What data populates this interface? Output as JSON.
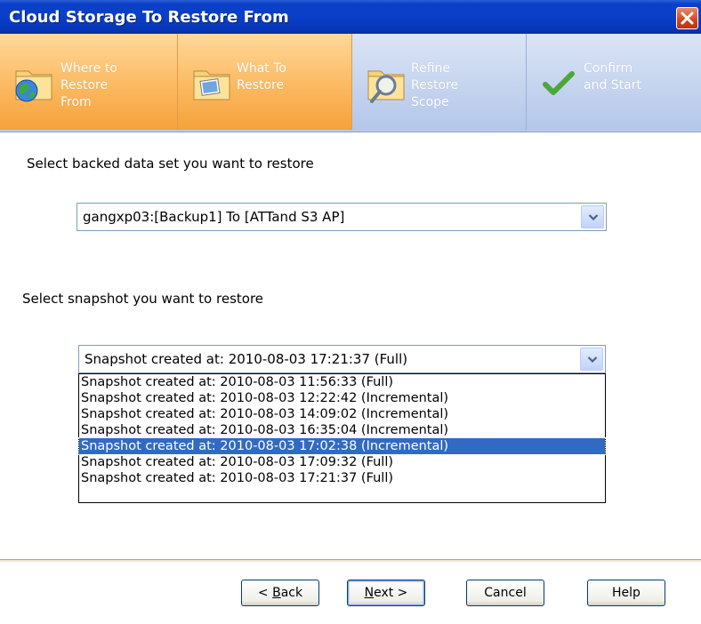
{
  "window": {
    "title": "Cloud Storage To Restore From"
  },
  "steps": [
    {
      "label_lines": [
        "Where to",
        "Restore",
        "From"
      ],
      "state": "active",
      "icon": "globe-folder-icon"
    },
    {
      "label_lines": [
        "What To",
        "Restore"
      ],
      "state": "active",
      "icon": "picture-folder-icon"
    },
    {
      "label_lines": [
        "Refine",
        "Restore",
        "Scope"
      ],
      "state": "inactive",
      "icon": "magnifier-folder-icon"
    },
    {
      "label_lines": [
        "Confirm",
        "and Start"
      ],
      "state": "inactive",
      "icon": "checkmark-icon"
    }
  ],
  "dataset": {
    "prompt": "Select backed data set you want to restore",
    "value": "gangxp03:[Backup1] To [ATTand S3 AP]"
  },
  "snapshot": {
    "prompt": "Select snapshot you want to restore",
    "value": "Snapshot created at: 2010-08-03 17:21:37 (Full)",
    "options": [
      "Snapshot created at: 2010-08-03 11:56:33 (Full)",
      "Snapshot created at: 2010-08-03 12:22:42 (Incremental)",
      "Snapshot created at: 2010-08-03 14:09:02 (Incremental)",
      "Snapshot created at: 2010-08-03 16:35:04 (Incremental)",
      "Snapshot created at: 2010-08-03 17:02:38 (Incremental)",
      "Snapshot created at: 2010-08-03 17:09:32 (Full)",
      "Snapshot created at: 2010-08-03 17:21:37 (Full)"
    ],
    "highlighted_index": 4
  },
  "buttons": {
    "back": {
      "prefix": "< ",
      "mnemonic": "B",
      "rest": "ack"
    },
    "next": {
      "mnemonic": "N",
      "rest": "ext >"
    },
    "cancel": "Cancel",
    "help": "Help"
  },
  "colors": {
    "title_bar": "#0a3fc6",
    "active_step": "#fbb65c",
    "inactive_step": "#c3d2ee",
    "selection": "#316ac5"
  }
}
